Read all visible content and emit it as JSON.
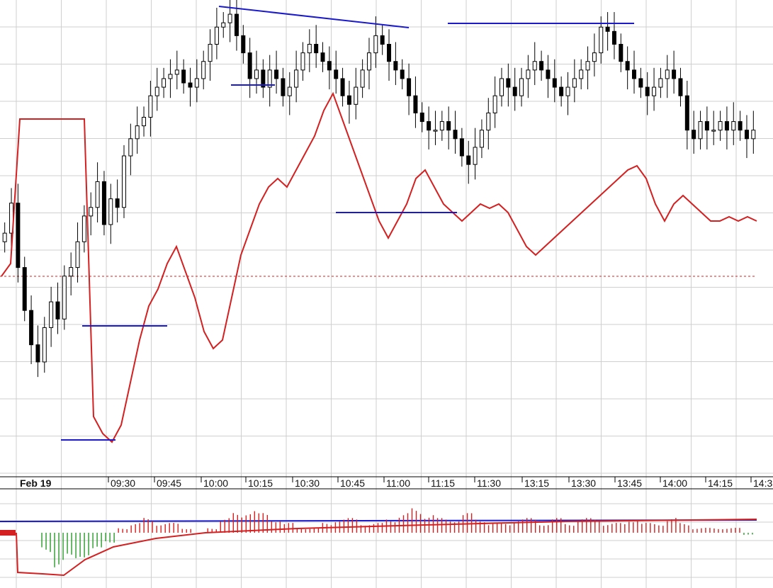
{
  "chart_data": {
    "type": "candlestick",
    "title": "",
    "xlabel": "",
    "ylabel": "",
    "date_label": "Feb 19",
    "time_labels": [
      "09:30",
      "09:45",
      "10:00",
      "10:15",
      "10:30",
      "10:45",
      "11:00",
      "11:15",
      "11:30",
      "13:15",
      "13:30",
      "13:45",
      "14:00",
      "14:15",
      "14:3"
    ],
    "grid": true,
    "y_range_normalized": [
      0,
      100
    ],
    "reference_level": 50,
    "price_series": {
      "description": "intraday candles (relative price scale, 0=bottom of price pane, 100=top)",
      "close_path": [
        48,
        55,
        40,
        30,
        22,
        18,
        26,
        32,
        28,
        38,
        40,
        46,
        52,
        54,
        60,
        50,
        56,
        54,
        66,
        70,
        73,
        75,
        80,
        82,
        84,
        85,
        86,
        83,
        82,
        84,
        88,
        92,
        96,
        97,
        99,
        94,
        90,
        84,
        86,
        82,
        86,
        84,
        80,
        82,
        86,
        90,
        92,
        90,
        88,
        86,
        84,
        80,
        78,
        82,
        86,
        90,
        94,
        92,
        88,
        86,
        84,
        80,
        76,
        74,
        72,
        72,
        74,
        72,
        70,
        66,
        64,
        68,
        72,
        76,
        80,
        84,
        82,
        80,
        84,
        86,
        88,
        86,
        84,
        82,
        80,
        82,
        84,
        86,
        88,
        90,
        96,
        95,
        92,
        88,
        86,
        84,
        82,
        80,
        82,
        84,
        86,
        84,
        80,
        72,
        70,
        74,
        72,
        72,
        74,
        72,
        74,
        72,
        70,
        72
      ]
    },
    "oscillator_line": {
      "color": "#d42020",
      "values": [
        45,
        48,
        82,
        82,
        82,
        82,
        82,
        82,
        82,
        82,
        12,
        8,
        6,
        10,
        20,
        30,
        38,
        42,
        48,
        52,
        46,
        40,
        32,
        28,
        30,
        40,
        50,
        56,
        62,
        66,
        68,
        66,
        70,
        74,
        78,
        84,
        88,
        82,
        76,
        70,
        64,
        58,
        54,
        58,
        62,
        68,
        70,
        66,
        62,
        60,
        58,
        60,
        62,
        61,
        62,
        60,
        56,
        52,
        50,
        52,
        54,
        56,
        58,
        60,
        62,
        64,
        66,
        68,
        70,
        71,
        68,
        62,
        58,
        62,
        64,
        62,
        60,
        58,
        58,
        59,
        58,
        59,
        58
      ]
    },
    "histogram": {
      "description": "lower indicator pane bars (positive red, negative green)",
      "values": [
        0,
        0,
        -4,
        -7,
        -6,
        -5,
        -4,
        -2,
        1,
        2,
        3,
        2,
        2,
        1,
        0,
        1,
        3,
        4,
        5,
        4,
        3,
        2,
        1,
        1,
        2,
        3,
        3,
        2,
        2,
        3,
        4,
        5,
        4,
        3,
        3,
        4,
        3,
        2,
        2,
        3,
        3,
        2,
        3,
        2,
        3,
        3,
        2,
        2,
        3,
        2,
        2,
        3,
        2,
        1,
        1,
        1,
        1,
        -0.5
      ],
      "signal_line_color": "#1a1acc",
      "oscillator_color": "#d42020"
    },
    "annotations": [
      {
        "type": "trendline",
        "color": "#1a1acc",
        "label": ""
      },
      {
        "type": "horizontal_line",
        "color": "#1a1acc",
        "label": ""
      }
    ]
  },
  "colors": {
    "background": "#ffffff",
    "grid": "#cfcfcf",
    "candle_up_body": "#ffffff",
    "candle_down_body": "#000000",
    "candle_outline": "#000000",
    "oscillator": "#d42020",
    "drawings": "#1a1acc",
    "hist_pos": "#d42020",
    "hist_neg": "#2a9a2a",
    "ref_line": "#d42020"
  }
}
